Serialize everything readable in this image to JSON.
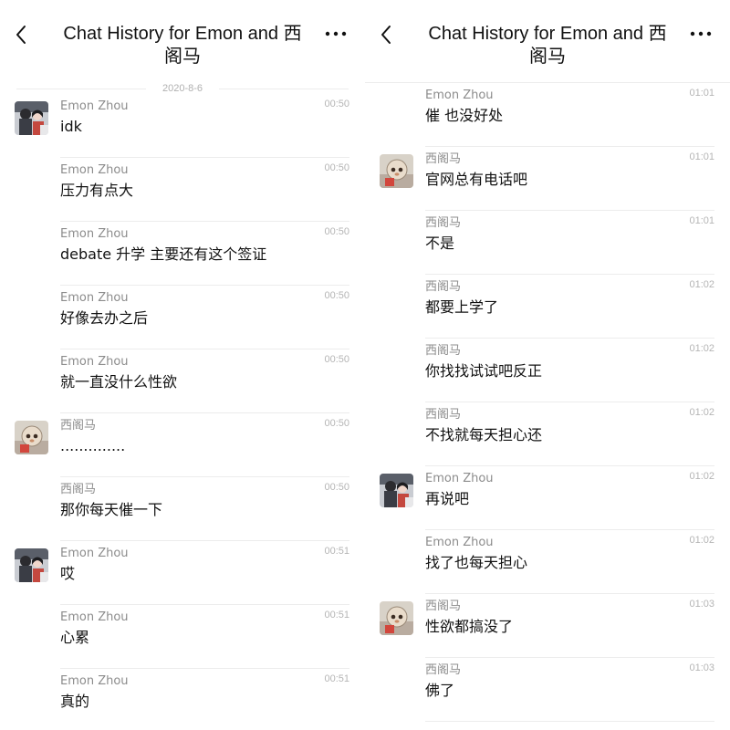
{
  "icons": {
    "back": "chevron-left-icon",
    "more": "more-horizontal-icon"
  },
  "colors": {
    "text": "#111111",
    "secondary": "#8c8c8c",
    "timestamp": "#b5b5b5",
    "divider": "#ececec"
  },
  "left": {
    "title": "Chat History for Emon and 西阁马",
    "date": "2020-8-6",
    "messages": [
      {
        "sender": "Emon Zhou",
        "time": "00:50",
        "text": "idk",
        "avatar": "emon"
      },
      {
        "sender": "Emon Zhou",
        "time": "00:50",
        "text": "压力有点大",
        "avatar": ""
      },
      {
        "sender": "Emon Zhou",
        "time": "00:50",
        "text": "debate 升学 主要还有这个签证",
        "avatar": ""
      },
      {
        "sender": "Emon Zhou",
        "time": "00:50",
        "text": "好像去办之后",
        "avatar": ""
      },
      {
        "sender": "Emon Zhou",
        "time": "00:50",
        "text": "就一直没什么性欲",
        "avatar": ""
      },
      {
        "sender": "西阁马",
        "time": "00:50",
        "text": "..............",
        "avatar": "xigema"
      },
      {
        "sender": "西阁马",
        "time": "00:50",
        "text": "那你每天催一下",
        "avatar": ""
      },
      {
        "sender": "Emon Zhou",
        "time": "00:51",
        "text": "哎",
        "avatar": "emon"
      },
      {
        "sender": "Emon Zhou",
        "time": "00:51",
        "text": "心累",
        "avatar": ""
      },
      {
        "sender": "Emon Zhou",
        "time": "00:51",
        "text": "真的",
        "avatar": ""
      }
    ]
  },
  "right": {
    "title": "Chat History for Emon and 西阁马",
    "messages": [
      {
        "sender": "Emon Zhou",
        "time": "01:01",
        "text": "催 也没好处",
        "avatar": ""
      },
      {
        "sender": "西阁马",
        "time": "01:01",
        "text": "官网总有电话吧",
        "avatar": "xigema"
      },
      {
        "sender": "西阁马",
        "time": "01:01",
        "text": "不是",
        "avatar": ""
      },
      {
        "sender": "西阁马",
        "time": "01:02",
        "text": "都要上学了",
        "avatar": ""
      },
      {
        "sender": "西阁马",
        "time": "01:02",
        "text": "你找找试试吧反正",
        "avatar": ""
      },
      {
        "sender": "西阁马",
        "time": "01:02",
        "text": "不找就每天担心还",
        "avatar": ""
      },
      {
        "sender": "Emon Zhou",
        "time": "01:02",
        "text": "再说吧",
        "avatar": "emon"
      },
      {
        "sender": "Emon Zhou",
        "time": "01:02",
        "text": "找了也每天担心",
        "avatar": ""
      },
      {
        "sender": "西阁马",
        "time": "01:03",
        "text": "性欲都搞没了",
        "avatar": "xigema"
      },
      {
        "sender": "西阁马",
        "time": "01:03",
        "text": "佛了",
        "avatar": ""
      }
    ]
  }
}
